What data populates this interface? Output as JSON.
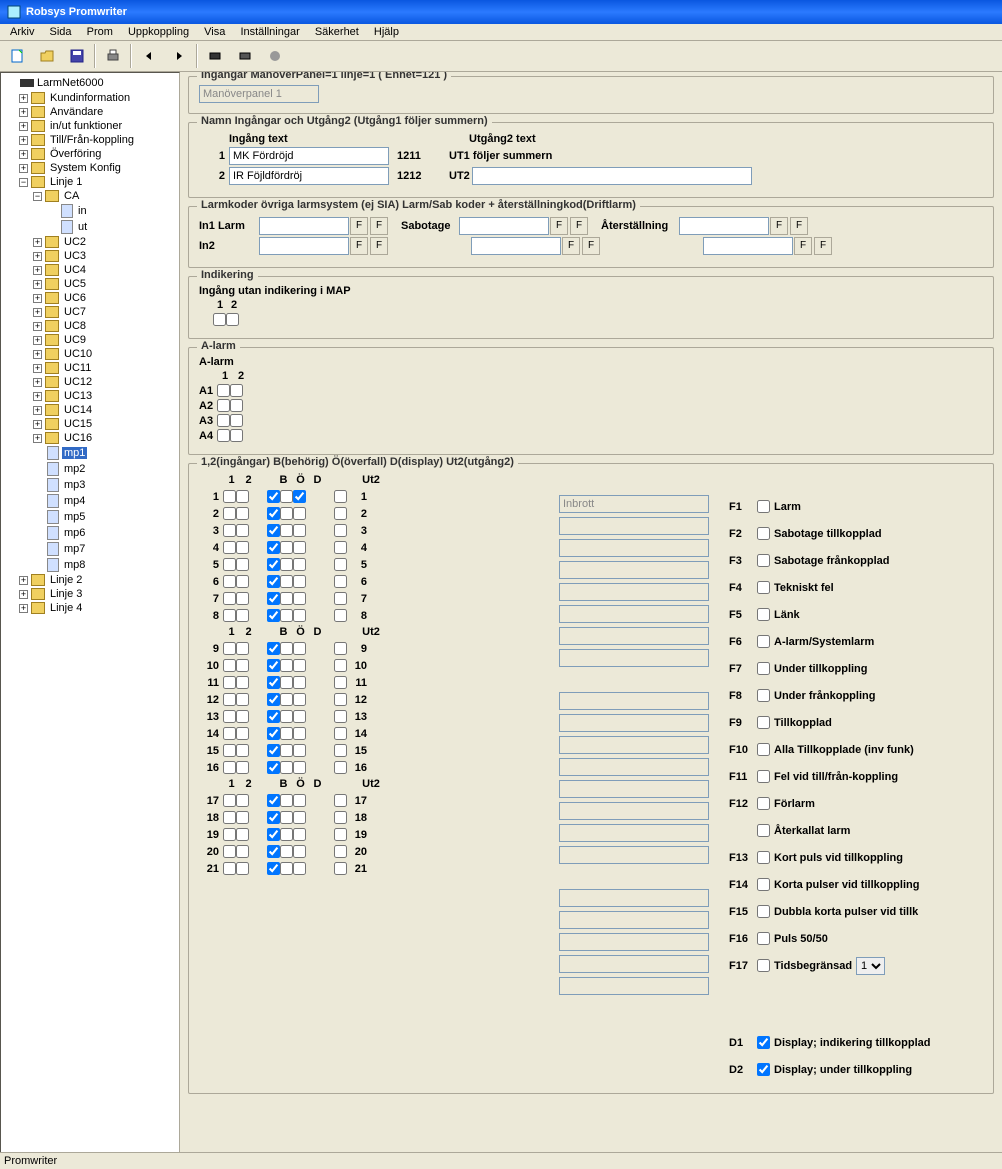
{
  "title": "Robsys Promwriter",
  "menus": [
    "Arkiv",
    "Sida",
    "Prom",
    "Uppkoppling",
    "Visa",
    "Inställningar",
    "Säkerhet",
    "Hjälp"
  ],
  "tree": {
    "root": "LarmNet6000",
    "level1": [
      "Kundinformation",
      "Användare",
      "in/ut funktioner",
      "Till/Från-koppling",
      "Överföring",
      "System Konfig"
    ],
    "linje1": "Linje 1",
    "ca": "CA",
    "ca_children": [
      "in",
      "ut"
    ],
    "uc": [
      "UC2",
      "UC3",
      "UC4",
      "UC5",
      "UC6",
      "UC7",
      "UC8",
      "UC9",
      "UC10",
      "UC11",
      "UC12",
      "UC13",
      "UC14",
      "UC15",
      "UC16"
    ],
    "mp_sel": "mp1",
    "mp": [
      "mp2",
      "mp3",
      "mp4",
      "mp5",
      "mp6",
      "mp7",
      "mp8"
    ],
    "linjes": [
      "Linje 2",
      "Linje 3",
      "Linje 4"
    ]
  },
  "g1": {
    "title": "Ingångar ManöverPanel=1 linje=1   ( Enhet=121 )",
    "disabled": "Manöverpanel 1"
  },
  "g2": {
    "title": "Namn Ingångar och Utgång2 (Utgång1 följer summern)",
    "col1_hdr": "Ingång text",
    "col2_hdr": "Utgång2 text",
    "r1_num": "1",
    "r1_in": "MK Fördröjd",
    "r1_code": "1211",
    "r1_out_label": "UT1 följer summern",
    "r2_num": "2",
    "r2_in": "IR Föjldfördröj",
    "r2_code": "1212",
    "r2_out_label": "UT2",
    "r2_out_val": ""
  },
  "g3": {
    "title": "Larmkoder övriga larmsystem (ej SIA)   Larm/Sab koder + återställningkod(Driftlarm)",
    "in1": "In1 Larm",
    "in2": "In2",
    "sab": "Sabotage",
    "ater": "Återställning"
  },
  "g4": {
    "title": "Indikering",
    "sub": "Ingång utan indikering i MAP",
    "h1": "1",
    "h2": "2"
  },
  "g5": {
    "title": "A-larm",
    "sub": "A-larm",
    "h1": "1",
    "h2": "2",
    "rows": [
      "A1",
      "A2",
      "A3",
      "A4"
    ]
  },
  "g6": {
    "title": "1,2(ingångar)  B(behörig) Ö(överfall) D(display) Ut2(utgång2)",
    "hdrs": {
      "c12": [
        "1",
        "2"
      ],
      "bod": [
        "B",
        "Ö",
        "D"
      ],
      "ut2": "Ut2"
    },
    "inbrott": "Inbrott",
    "f_labels": [
      "Larm",
      "Sabotage tillkopplad",
      "Sabotage frånkopplad",
      "Tekniskt fel",
      "Länk",
      "A-larm/Systemlarm",
      "Under tillkoppling",
      "Under frånkoppling",
      "Tillkopplad",
      "Alla Tillkopplade (inv funk)",
      "Fel vid till/från-koppling",
      "Förlarm"
    ],
    "aterkallat": "Återkallat larm",
    "f_labels2": [
      "Kort puls vid tillkoppling",
      "Korta pulser vid tillkoppling",
      "Dubbla korta pulser vid tillk",
      "Puls 50/50"
    ],
    "f17": "Tidsbegränsad",
    "f17_val": "1",
    "d1": "Display; indikering tillkopplad",
    "d2": "Display; under tillkoppling"
  },
  "status": "Promwriter"
}
